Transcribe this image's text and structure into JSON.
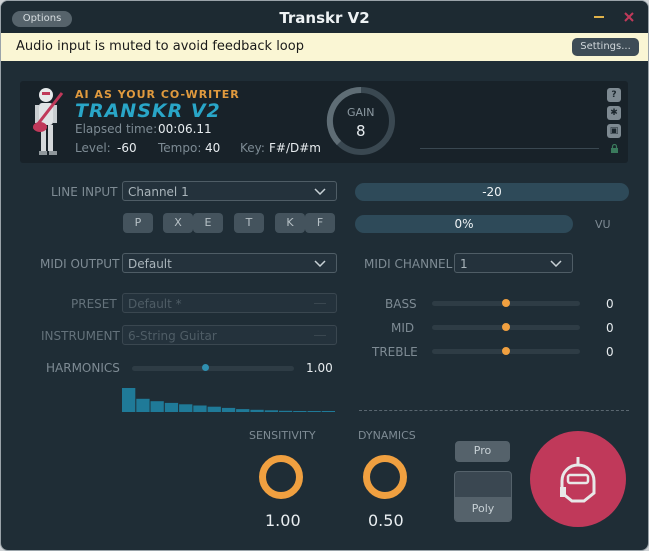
{
  "titlebar": {
    "options_label": "Options",
    "title": "Transkr V2"
  },
  "notice": {
    "text": "Audio input is muted to avoid feedback loop",
    "settings_label": "Settings..."
  },
  "header": {
    "tagline": "AI AS YOUR CO-WRITER",
    "brand": "TRANSKR V2",
    "elapsed_label": "Elapsed time:",
    "elapsed_value": "00:06.11",
    "level_label": "Level:",
    "level_value": "-60",
    "tempo_label": "Tempo:",
    "tempo_value": "40",
    "key_label": "Key:",
    "key_value": "F#/D#m",
    "gain_label": "GAIN",
    "gain_value": "8",
    "side_icons": [
      "help-icon",
      "bug-icon",
      "cart-icon",
      "lock-icon"
    ]
  },
  "input": {
    "line_input_label": "LINE INPUT",
    "line_input_value": "Channel 1",
    "mode_buttons": [
      "P",
      "X",
      "E",
      "T",
      "K",
      "F"
    ],
    "level_bar_value": "-20",
    "vu_percent": "0%",
    "vu_label": "VU"
  },
  "midi": {
    "output_label": "MIDI OUTPUT",
    "output_value": "Default",
    "channel_label": "MIDI CHANNEL",
    "channel_value": "1"
  },
  "sound": {
    "preset_label": "PRESET",
    "preset_value": "Default *",
    "instrument_label": "INSTRUMENT",
    "instrument_value": "6-String Guitar",
    "harmonics_label": "HARMONICS",
    "harmonics_value": "1.00",
    "harmonics_level": 0.45,
    "harmonic_spectrum": [
      1.0,
      0.55,
      0.45,
      0.38,
      0.32,
      0.27,
      0.22,
      0.17,
      0.12,
      0.09,
      0.07,
      0.05,
      0.03,
      0.02,
      0.01
    ]
  },
  "eq": {
    "bass_label": "BASS",
    "bass_value": "0",
    "bass_level": 0.5,
    "mid_label": "MID",
    "mid_value": "0",
    "mid_level": 0.5,
    "treble_label": "TREBLE",
    "treble_value": "0",
    "treble_level": 0.5
  },
  "controls": {
    "sensitivity_label": "SENSITIVITY",
    "sensitivity_value": "1.00",
    "dynamics_label": "DYNAMICS",
    "dynamics_value": "0.50",
    "pro_label": "Pro",
    "poly_label": "Poly"
  },
  "colors": {
    "accent_orange": "#f0a040",
    "brand_blue": "#29a6c8",
    "record_button": "#c0395a",
    "background": "#1f2d36"
  }
}
